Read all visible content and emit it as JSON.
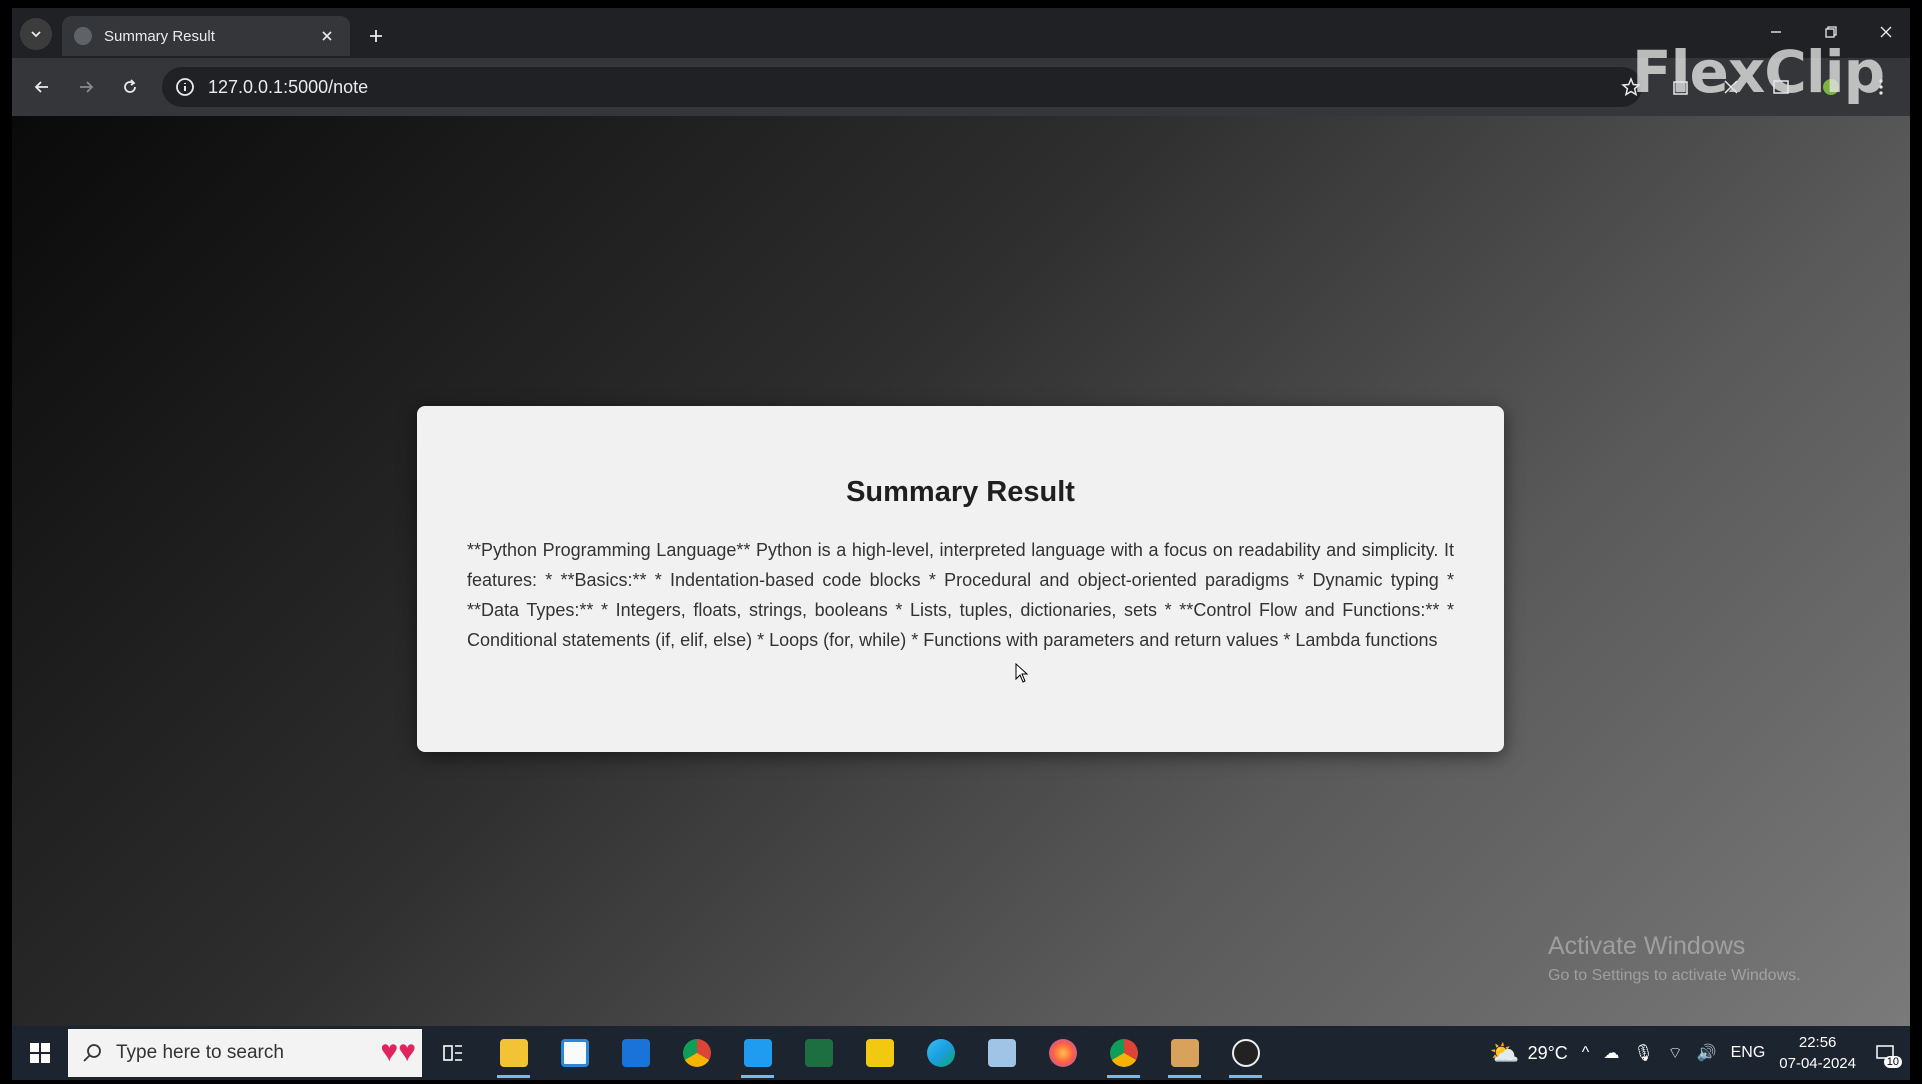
{
  "browser": {
    "tab_title": "Summary Result",
    "url": "127.0.0.1:5000/note"
  },
  "watermark": "FlexClip",
  "card": {
    "heading": "Summary Result",
    "body": "**Python Programming Language** Python is a high-level, interpreted language with a focus on readability and simplicity. It features: * **Basics:** * Indentation-based code blocks * Procedural and object-oriented paradigms * Dynamic typing * **Data Types:** * Integers, floats, strings, booleans * Lists, tuples, dictionaries, sets * **Control Flow and Functions:** * Conditional statements (if, elif, else) * Loops (for, while) * Functions with parameters and return values * Lambda functions"
  },
  "activation": {
    "title": "Activate Windows",
    "subtitle": "Go to Settings to activate Windows."
  },
  "taskbar": {
    "search_placeholder": "Type here to search",
    "apps": [
      "task-view",
      "file-explorer",
      "microsoft-store",
      "mail",
      "chrome",
      "vscode",
      "excel",
      "power-bi",
      "edge",
      "notepad",
      "firefox",
      "chrome-active",
      "package",
      "obs"
    ],
    "weather": "29°C",
    "language": "ENG",
    "time": "22:56",
    "date": "07-04-2024",
    "notification_count": "10"
  },
  "colors": {
    "card_bg": "#f1f1f1",
    "taskbar_bg": "#1c2430",
    "browser_bg": "#202124"
  }
}
